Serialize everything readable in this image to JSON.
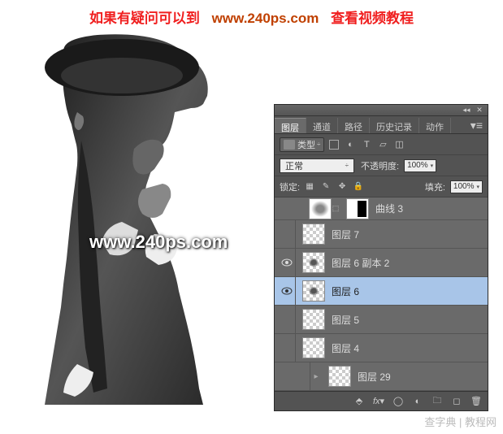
{
  "banner": {
    "text1": "如果有疑问可以到",
    "link": "www.240ps.com",
    "text2": "查看视频教程"
  },
  "watermark": "www.240ps.com",
  "panel": {
    "tabs": {
      "layers": "图层",
      "channels": "通道",
      "paths": "路径",
      "history": "历史记录",
      "actions": "动作"
    },
    "type_label": "类型",
    "blend_mode": "正常",
    "opacity_label": "不透明度:",
    "opacity_value": "100%",
    "lock_label": "锁定:",
    "fill_label": "填充:",
    "fill_value": "100%"
  },
  "layers": [
    {
      "name": "曲线 3",
      "visible": false,
      "type": "adjustment"
    },
    {
      "name": "图层 7",
      "visible": false,
      "type": "pixel"
    },
    {
      "name": "图层 6 副本 2",
      "visible": true,
      "type": "pixel"
    },
    {
      "name": "图层 6",
      "visible": true,
      "type": "pixel",
      "selected": true
    },
    {
      "name": "图层 5",
      "visible": false,
      "type": "pixel"
    },
    {
      "name": "图层 4",
      "visible": false,
      "type": "pixel"
    },
    {
      "name": "图层 29",
      "visible": false,
      "type": "pixel",
      "nested": true
    }
  ],
  "footer_watermark": "查字典 | 教程网"
}
